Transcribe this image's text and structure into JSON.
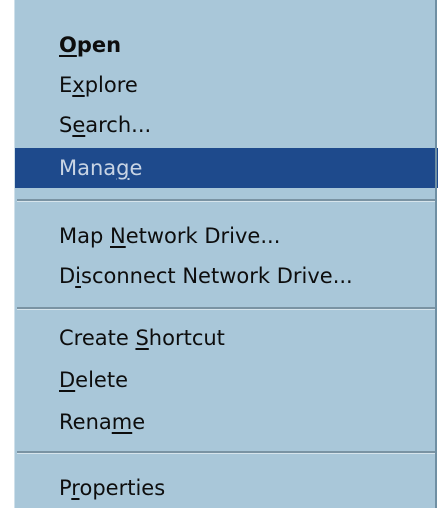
{
  "context_menu": {
    "items": [
      {
        "pre": "",
        "key": "O",
        "post": "pen"
      },
      {
        "pre": "E",
        "key": "x",
        "post": "plore"
      },
      {
        "pre": "S",
        "key": "e",
        "post": "arch..."
      },
      {
        "pre": "Mana",
        "key": "g",
        "post": "e"
      },
      {
        "pre": "Map ",
        "key": "N",
        "post": "etwork Drive..."
      },
      {
        "pre": "D",
        "key": "i",
        "post": "sconnect Network Drive..."
      },
      {
        "pre": "Create ",
        "key": "S",
        "post": "hortcut"
      },
      {
        "pre": "",
        "key": "D",
        "post": "elete"
      },
      {
        "pre": "Rena",
        "key": "m",
        "post": "e"
      },
      {
        "pre": "P",
        "key": "r",
        "post": "operties"
      }
    ],
    "highlighted_item": "Manage",
    "colors": {
      "menu_background": "#a9c7d9",
      "highlight_background": "#1e4a8c",
      "highlight_text": "#c8d4e4"
    }
  }
}
